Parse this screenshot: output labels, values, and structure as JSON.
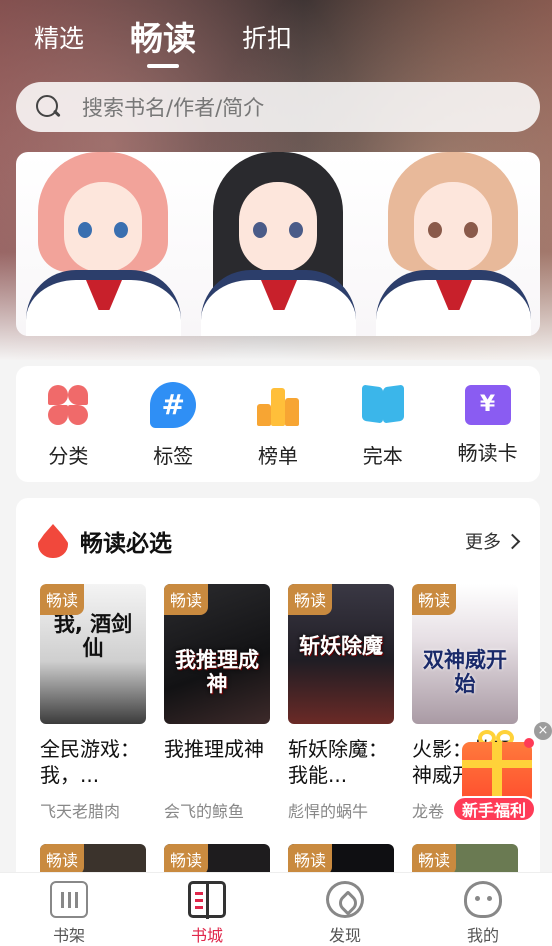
{
  "top_tabs": [
    {
      "label": "精选",
      "active": false
    },
    {
      "label": "畅读",
      "active": true
    },
    {
      "label": "折扣",
      "active": false
    }
  ],
  "search": {
    "placeholder": "搜索书名/作者/简介",
    "icon": "search-icon"
  },
  "banner": {
    "figures": [
      {
        "hair": "#f2a39a"
      },
      {
        "hair": "#2a2a2e"
      },
      {
        "hair": "#e8b99a"
      }
    ]
  },
  "categories": [
    {
      "label": "分类",
      "icon": "flower-icon",
      "color": "#f06a6a"
    },
    {
      "label": "标签",
      "icon": "hashtag-icon",
      "color": "#2f8ff5"
    },
    {
      "label": "榜单",
      "icon": "ranking-icon",
      "color": "#f7a533"
    },
    {
      "label": "完本",
      "icon": "book-icon",
      "color": "#3bb6ea"
    },
    {
      "label": "畅读卡",
      "icon": "vip-card-icon",
      "color": "#8a5cf2"
    }
  ],
  "section": {
    "title": "畅读必选",
    "more": "更多",
    "badge": "畅读",
    "books": [
      {
        "cover_text": "我, 酒剑仙",
        "name": "全民游戏：我，...",
        "author": "飞天老腊肉",
        "c1": "#eeeeee",
        "c2": "#555555"
      },
      {
        "cover_text": "我推理成神",
        "name": "我推理成神",
        "author": "会飞的鲸鱼",
        "c1": "#1b1b1d",
        "c2": "#3a3438"
      },
      {
        "cover_text": "斩妖除魔",
        "name": "斩妖除魔：我能...",
        "author": "彪悍的蜗牛",
        "c1": "#2a2630",
        "c2": "#7a3a34"
      },
      {
        "cover_text": "双神威开始",
        "name": "火影：从双神威开始",
        "author": "龙卷",
        "c1": "#ffffff",
        "c2": "#c9c3c8"
      }
    ],
    "row2_colors": [
      "#3b332c",
      "#1e1c1e",
      "#0f0f12",
      "#6a7a52"
    ]
  },
  "gift": {
    "label": "新手福利",
    "close": "×"
  },
  "nav": [
    {
      "label": "书架",
      "icon": "bookshelf-icon",
      "active": false
    },
    {
      "label": "书城",
      "icon": "bookstore-icon",
      "active": true
    },
    {
      "label": "发现",
      "icon": "compass-icon",
      "active": false
    },
    {
      "label": "我的",
      "icon": "profile-icon",
      "active": false
    }
  ]
}
